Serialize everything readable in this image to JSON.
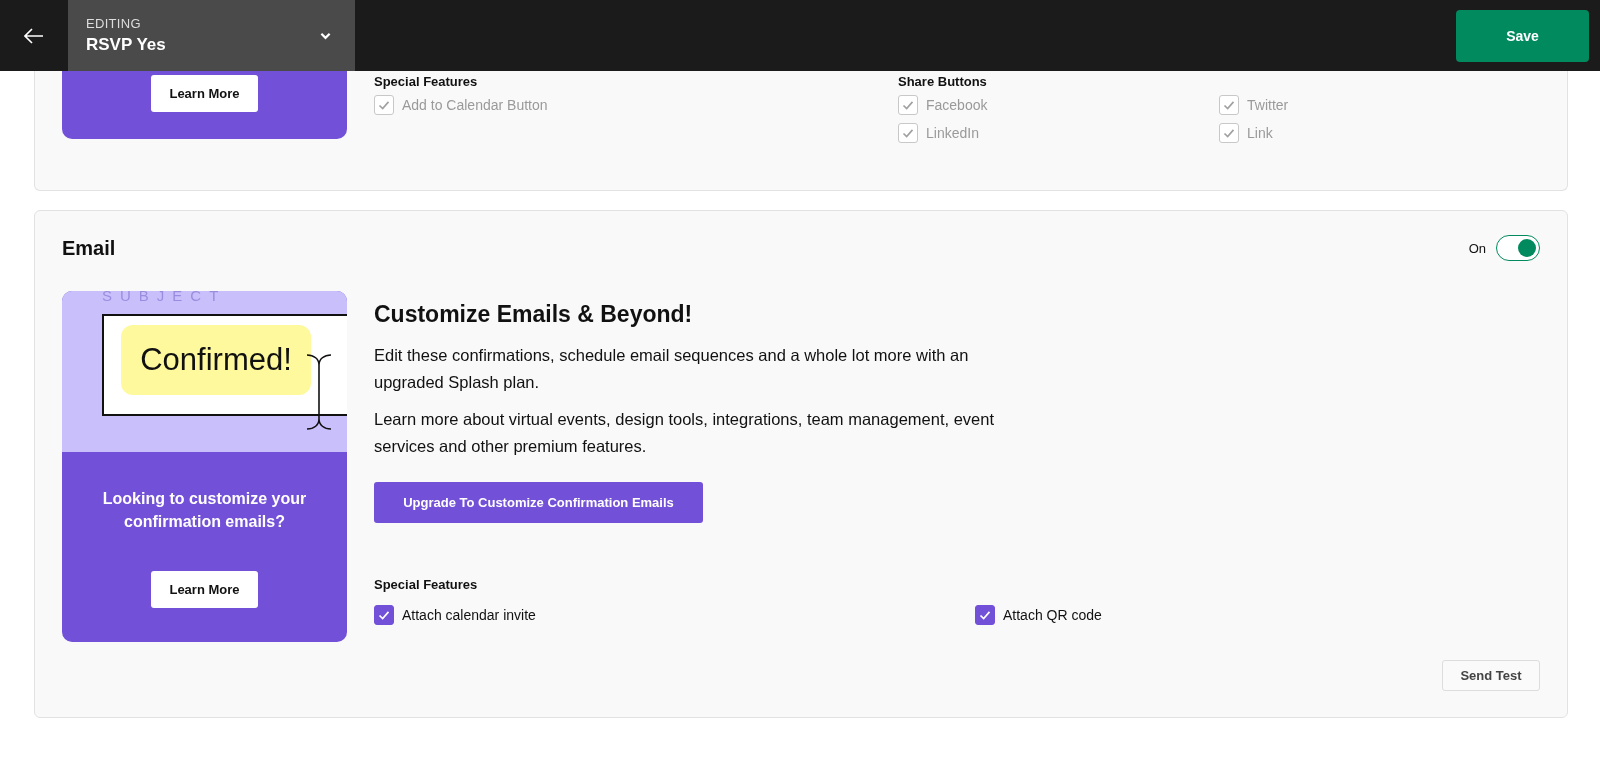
{
  "header": {
    "editing_label": "EDITING",
    "editing_title": "RSVP Yes",
    "save_button": "Save"
  },
  "sections": [
    {
      "kind": "web",
      "promo": {
        "button": "Learn More"
      },
      "feature_groups": [
        {
          "title": "Special Features",
          "options": [
            {
              "label": "Add to Calendar Button",
              "checked": true,
              "disabled": true
            }
          ]
        },
        {
          "title": "Share Buttons",
          "options": [
            {
              "label": "Facebook",
              "checked": true,
              "disabled": true
            },
            {
              "label": "Twitter",
              "checked": true,
              "disabled": true
            },
            {
              "label": "LinkedIn",
              "checked": true,
              "disabled": true
            },
            {
              "label": "Link",
              "checked": true,
              "disabled": true
            }
          ]
        }
      ]
    },
    {
      "kind": "email",
      "title": "Email",
      "toggle": {
        "label": "On",
        "on": true
      },
      "promo": {
        "subject_label": "SUBJECT",
        "preview_text": "Confirmed!",
        "message": "Looking to customize your confirmation emails?",
        "button": "Learn More"
      },
      "heading": "Customize Emails & Beyond!",
      "paragraphs": [
        "Edit these confirmations, schedule email sequences and a whole lot more with an upgraded Splash plan.",
        "Learn more about virtual events, design tools, integrations, team management, event services and other premium features."
      ],
      "upgrade_button": "Upgrade To Customize Confirmation Emails",
      "feature_groups": [
        {
          "title": "Special Features",
          "options": [
            {
              "label": "Attach calendar invite",
              "checked": true,
              "disabled": false
            },
            {
              "label": "Attach QR code",
              "checked": true,
              "disabled": false
            }
          ]
        }
      ],
      "send_test_button": "Send Test"
    }
  ]
}
